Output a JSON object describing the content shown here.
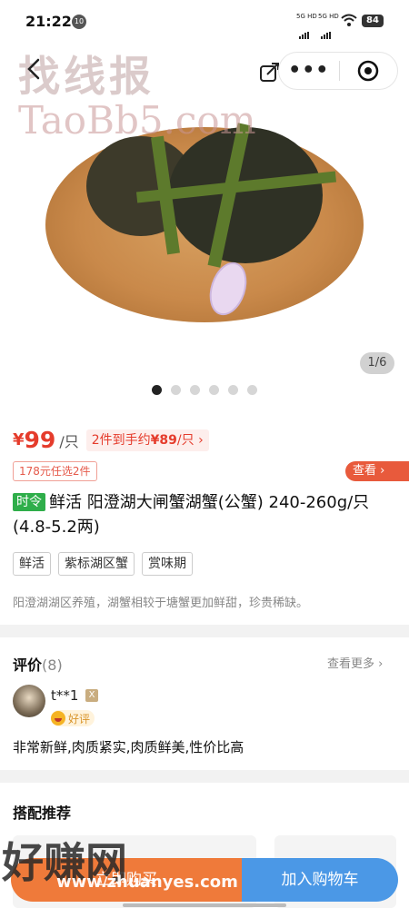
{
  "status_bar": {
    "time": "21:22",
    "notification_badge": "10",
    "signal1": "5G HD",
    "signal2": "5G HD",
    "battery": "84"
  },
  "watermark": {
    "top_text": "找线报",
    "top_url": "TaoBb5.com",
    "bottom_text": "好赚网",
    "bottom_url": "www.zhuanyes.com"
  },
  "gallery": {
    "page_indicator": "1/6",
    "dot_count": 6,
    "active_index": 0
  },
  "product": {
    "price_symbol": "¥",
    "price": "99",
    "unit": "/只",
    "promo_prefix": "2件到手约",
    "promo_price": "¥89",
    "promo_suffix": "/只",
    "coupon": "178元任选2件",
    "view_label": "查看",
    "season_tag": "时令",
    "title": "鲜活 阳澄湖大闸蟹湖蟹(公蟹) 240-260g/只(4.8-5.2两)",
    "tags": [
      "鲜活",
      "紫标湖区蟹",
      "赏味期"
    ],
    "description": "阳澄湖湖区养殖，湖蟹相较于塘蟹更加鲜甜，珍贵稀缺。"
  },
  "reviews": {
    "title": "评价",
    "count": "(8)",
    "see_more": "查看更多",
    "username": "t**1",
    "user_badge": "X",
    "rating_label": "好评",
    "text": "非常新鲜,肉质紧实,肉质鲜美,性价比高"
  },
  "recommendations": {
    "title": "搭配推荐"
  },
  "bottom_bar": {
    "buy_label": "立即购买",
    "cart_label": "加入购物车"
  },
  "colors": {
    "price_red": "#e53c2c",
    "season_green": "#2fae4a",
    "buy_orange": "#ef7a3a",
    "cart_blue": "#4b98e6"
  }
}
